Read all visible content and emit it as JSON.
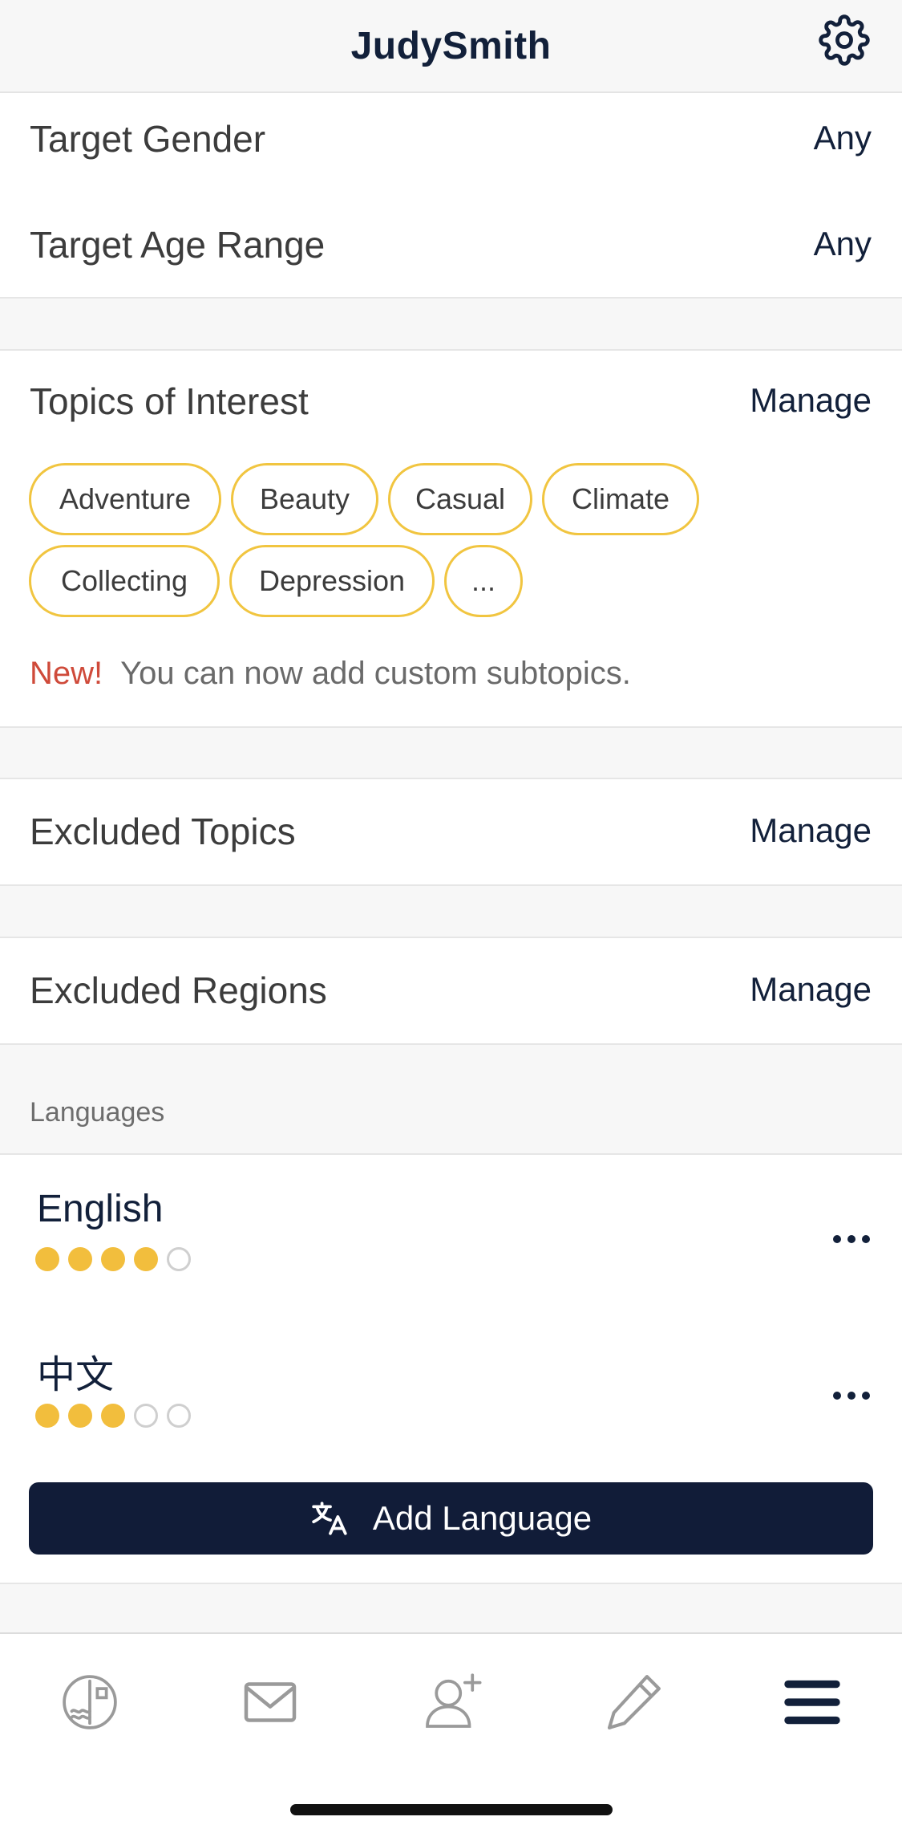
{
  "header": {
    "title": "JudySmith",
    "settings_icon": "gear-icon"
  },
  "target": {
    "gender_label": "Target Gender",
    "gender_value": "Any",
    "age_label": "Target Age Range",
    "age_value": "Any"
  },
  "topics": {
    "title": "Topics of Interest",
    "manage_label": "Manage",
    "chips": [
      "Adventure",
      "Beauty",
      "Casual",
      "Climate",
      "Collecting",
      "Depression",
      "..."
    ],
    "new_tag": "New!",
    "new_text": "You can now add custom subtopics."
  },
  "excluded_topics": {
    "title": "Excluded Topics",
    "manage_label": "Manage"
  },
  "excluded_regions": {
    "title": "Excluded Regions",
    "manage_label": "Manage"
  },
  "languages": {
    "group_label": "Languages",
    "items": [
      {
        "name": "English",
        "level": 4,
        "max": 5
      },
      {
        "name": "中文",
        "level": 3,
        "max": 5
      }
    ],
    "add_label": "Add Language"
  },
  "tabbar": {
    "items": [
      "letters-icon",
      "mail-icon",
      "add-friend-icon",
      "pencil-icon",
      "menu-icon"
    ],
    "active": "menu-icon"
  },
  "colors": {
    "navy": "#12203a",
    "accent_yellow": "#f2be3d",
    "new_red": "#cf4a3a"
  }
}
